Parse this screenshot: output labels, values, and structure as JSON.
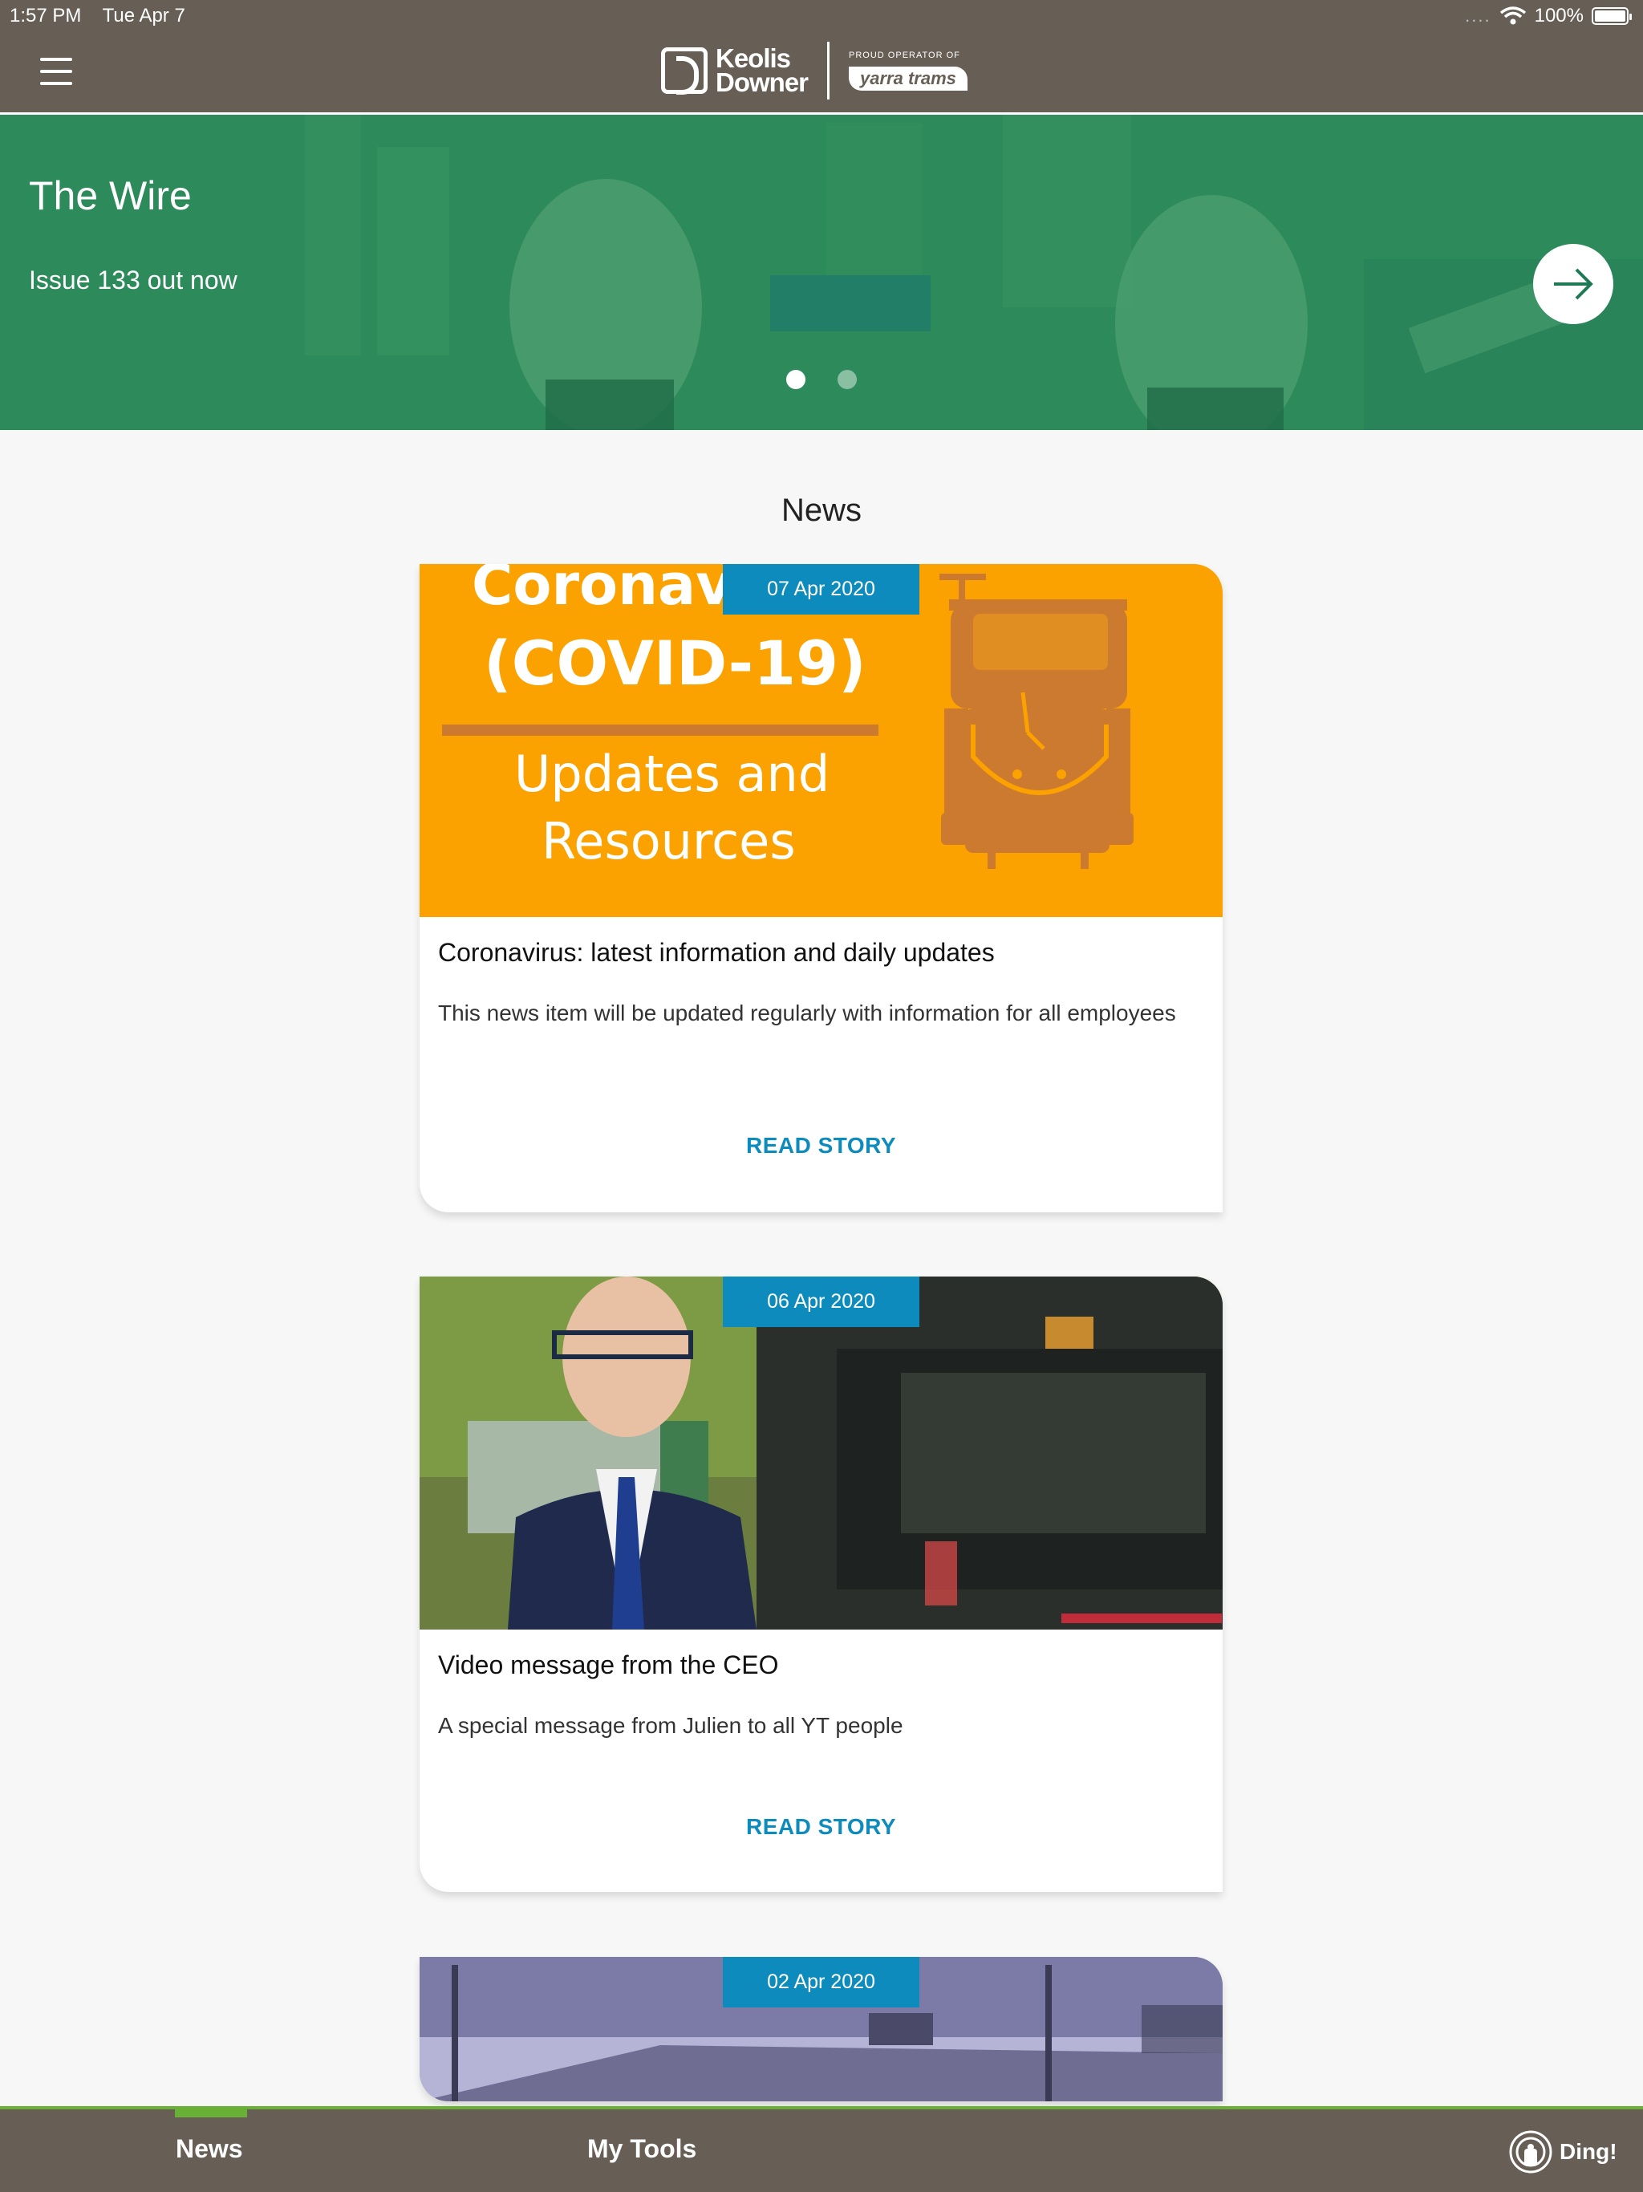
{
  "status_bar": {
    "time": "1:57 PM",
    "date": "Tue Apr 7",
    "signal": "....",
    "battery": "100%"
  },
  "header": {
    "logo_line1": "Keolis",
    "logo_line2": "Downer",
    "proud_text": "PROUD OPERATOR OF",
    "partner_logo": "yarra trams"
  },
  "hero": {
    "title": "The Wire",
    "subtitle": "Issue 133 out now",
    "slides": 2,
    "active_slide": 1
  },
  "news": {
    "heading": "News",
    "items": [
      {
        "date": "07 Apr 2020",
        "image_text": [
          "Coronav",
          "(COVID-19)",
          "Updates and",
          "Resources"
        ],
        "title": "Coronavirus: latest information and daily updates",
        "description": "This news item will be updated regularly with information for all employees",
        "link": "READ STORY"
      },
      {
        "date": "06 Apr 2020",
        "title": "Video message from the CEO",
        "description": "A special message from Julien to all YT people",
        "link": "READ STORY"
      },
      {
        "date": "02 Apr 2020"
      }
    ]
  },
  "tabs": {
    "news": "News",
    "tools": "My Tools",
    "ding": "Ding!"
  },
  "colors": {
    "header_bg": "#675f55",
    "accent_blue": "#0d8bbd",
    "accent_green": "#69b036",
    "hero_green": "#2b8a58",
    "covid_orange": "#fba100"
  }
}
